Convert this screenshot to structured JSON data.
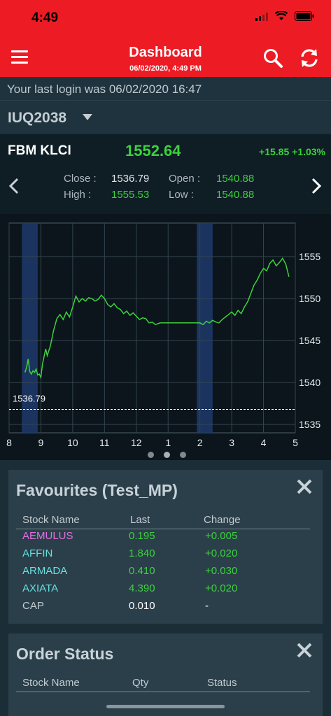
{
  "status_bar": {
    "time": "4:49"
  },
  "header": {
    "title": "Dashboard",
    "subtitle": "06/02/2020, 4:49 PM"
  },
  "last_login": "Your last login was 06/02/2020 16:47",
  "account": {
    "id": "IUQ2038"
  },
  "index": {
    "name": "FBM KLCI",
    "value": "1552.64",
    "change": "+15.85 +1.03%",
    "close_label": "Close :",
    "close": "1536.79",
    "open_label": "Open :",
    "open": "1540.88",
    "high_label": "High :",
    "high": "1555.53",
    "low_label": "Low :",
    "low": "1540.88"
  },
  "chart_data": {
    "type": "line",
    "x_ticks": [
      "8",
      "9",
      "10",
      "11",
      "12",
      "1",
      "2",
      "3",
      "4",
      "5"
    ],
    "y_ticks": [
      "1535",
      "1540",
      "1545",
      "1550",
      "1555"
    ],
    "ylim": [
      1534,
      1559
    ],
    "xlim": [
      8,
      17
    ],
    "reference_line": {
      "label": "1536.79",
      "value": 1536.79
    },
    "series": [
      {
        "x": [
          8.5,
          8.55,
          8.6,
          8.65,
          8.7,
          8.75,
          8.8,
          8.85,
          8.9,
          8.95,
          9.0,
          9.05,
          9.1,
          9.15,
          9.2,
          9.3,
          9.4,
          9.5,
          9.6,
          9.7,
          9.8,
          9.9,
          10.0,
          10.1,
          10.2,
          10.3,
          10.4,
          10.5,
          10.6,
          10.7,
          10.8,
          10.9,
          11.0,
          11.1,
          11.2,
          11.3,
          11.4,
          11.5,
          11.6,
          11.7,
          11.8,
          11.9,
          12.0,
          12.1,
          12.2,
          12.3,
          12.4,
          12.5,
          12.6,
          12.75,
          13.0,
          13.25,
          13.5,
          13.75,
          14.0,
          14.1,
          14.2,
          14.3,
          14.4,
          14.5,
          14.6,
          14.7,
          14.8,
          14.9,
          15.0,
          15.1,
          15.2,
          15.3,
          15.4,
          15.5,
          15.6,
          15.7,
          15.8,
          15.9,
          16.0,
          16.1,
          16.2,
          16.3,
          16.4,
          16.5,
          16.6,
          16.7,
          16.8
        ],
        "values": [
          1541.2,
          1541.8,
          1542.8,
          1541.3,
          1541.0,
          1541.4,
          1541.2,
          1541.6,
          1540.9,
          1541.0,
          1540.6,
          1542.2,
          1543.1,
          1544.0,
          1543.2,
          1544.4,
          1546.2,
          1547.6,
          1548.1,
          1547.5,
          1548.4,
          1547.8,
          1549.0,
          1550.3,
          1549.6,
          1550.0,
          1549.7,
          1550.1,
          1550.0,
          1549.7,
          1549.9,
          1550.4,
          1550.0,
          1549.3,
          1549.0,
          1549.4,
          1548.9,
          1548.7,
          1548.2,
          1548.5,
          1548.0,
          1548.3,
          1547.9,
          1547.5,
          1547.7,
          1547.6,
          1547.1,
          1547.2,
          1546.9,
          1547.1,
          1547.1,
          1547.1,
          1547.1,
          1547.1,
          1547.1,
          1546.9,
          1547.3,
          1547.1,
          1547.4,
          1547.2,
          1547.1,
          1547.5,
          1547.8,
          1548.1,
          1548.4,
          1548.0,
          1548.6,
          1548.2,
          1549.0,
          1549.6,
          1550.6,
          1551.6,
          1552.2,
          1553.0,
          1553.6,
          1553.3,
          1554.2,
          1554.6,
          1553.9,
          1554.3,
          1554.8,
          1554.1,
          1552.6
        ]
      }
    ],
    "highlights": [
      [
        8.4,
        8.9
      ],
      [
        13.9,
        14.4
      ]
    ],
    "grid": true
  },
  "favourites": {
    "title": "Favourites (Test_MP)",
    "headers": {
      "name": "Stock Name",
      "last": "Last",
      "change": "Change"
    },
    "rows": [
      {
        "name": "AEMULUS",
        "last": "0.195",
        "change": "+0.005",
        "name_color": "#e36ee3",
        "value_color": "#3cd23c"
      },
      {
        "name": "AFFIN",
        "last": "1.840",
        "change": "+0.020",
        "name_color": "#67e1df",
        "value_color": "#3cd23c"
      },
      {
        "name": "ARMADA",
        "last": "0.410",
        "change": "+0.030",
        "name_color": "#67e1df",
        "value_color": "#3cd23c"
      },
      {
        "name": "AXIATA",
        "last": "4.390",
        "change": "+0.020",
        "name_color": "#67e1df",
        "value_color": "#3cd23c"
      },
      {
        "name": "CAP",
        "last": "0.010",
        "change": "-",
        "name_color": "#c2cbd0",
        "value_color": "#ffffff"
      }
    ]
  },
  "order_status": {
    "title": "Order Status",
    "headers": {
      "name": "Stock Name",
      "qty": "Qty",
      "status": "Status"
    }
  },
  "colors": {
    "brand": "#ed1c24",
    "positive": "#3cd23c",
    "highlight": "#1e3a6b"
  },
  "icons": [
    "menu-icon",
    "search-icon",
    "refresh-icon",
    "chevron-left-icon",
    "chevron-right-icon",
    "close-icon",
    "wifi-icon",
    "battery-icon",
    "signal-icon"
  ]
}
